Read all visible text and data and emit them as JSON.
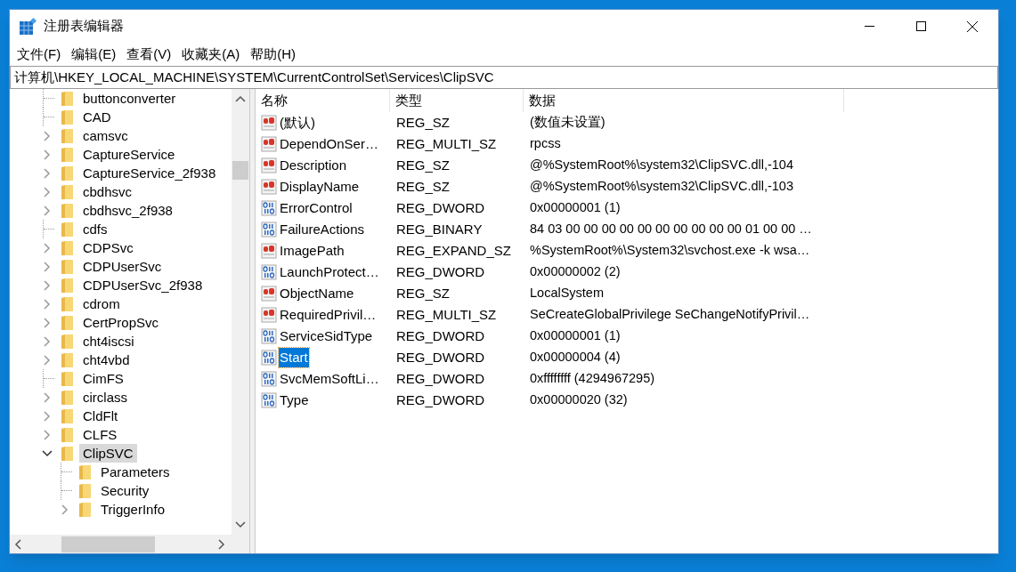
{
  "window": {
    "title": "注册表编辑器"
  },
  "menu": [
    "文件(F)",
    "编辑(E)",
    "查看(V)",
    "收藏夹(A)",
    "帮助(H)"
  ],
  "address": "计算机\\HKEY_LOCAL_MACHINE\\SYSTEM\\CurrentControlSet\\Services\\ClipSVC",
  "tree": [
    {
      "label": "buttonconverter",
      "kind": "leaf",
      "selected": false
    },
    {
      "label": "CAD",
      "kind": "leaf",
      "selected": false
    },
    {
      "label": "camsvc",
      "kind": "branch",
      "expanded": false,
      "selected": false
    },
    {
      "label": "CaptureService",
      "kind": "branch",
      "expanded": false,
      "selected": false
    },
    {
      "label": "CaptureService_2f938",
      "kind": "branch",
      "expanded": false,
      "selected": false
    },
    {
      "label": "cbdhsvc",
      "kind": "branch",
      "expanded": false,
      "selected": false
    },
    {
      "label": "cbdhsvc_2f938",
      "kind": "branch",
      "expanded": false,
      "selected": false
    },
    {
      "label": "cdfs",
      "kind": "leaf",
      "selected": false
    },
    {
      "label": "CDPSvc",
      "kind": "branch",
      "expanded": false,
      "selected": false
    },
    {
      "label": "CDPUserSvc",
      "kind": "branch",
      "expanded": false,
      "selected": false
    },
    {
      "label": "CDPUserSvc_2f938",
      "kind": "branch",
      "expanded": false,
      "selected": false
    },
    {
      "label": "cdrom",
      "kind": "branch",
      "expanded": false,
      "selected": false
    },
    {
      "label": "CertPropSvc",
      "kind": "branch",
      "expanded": false,
      "selected": false
    },
    {
      "label": "cht4iscsi",
      "kind": "branch",
      "expanded": false,
      "selected": false
    },
    {
      "label": "cht4vbd",
      "kind": "branch",
      "expanded": false,
      "selected": false
    },
    {
      "label": "CimFS",
      "kind": "leaf",
      "selected": false
    },
    {
      "label": "circlass",
      "kind": "branch",
      "expanded": false,
      "selected": false
    },
    {
      "label": "CldFlt",
      "kind": "branch",
      "expanded": false,
      "selected": false
    },
    {
      "label": "CLFS",
      "kind": "branch",
      "expanded": false,
      "selected": false
    },
    {
      "label": "ClipSVC",
      "kind": "branch",
      "expanded": true,
      "selected": true,
      "children": [
        {
          "label": "Parameters",
          "kind": "leaf",
          "selected": false
        },
        {
          "label": "Security",
          "kind": "leaf",
          "selected": false
        },
        {
          "label": "TriggerInfo",
          "kind": "branch",
          "expanded": false,
          "selected": false
        }
      ]
    }
  ],
  "columns": [
    "名称",
    "类型",
    "数据"
  ],
  "values": [
    {
      "name": "(默认)",
      "type": "REG_SZ",
      "data": "(数值未设置)",
      "kind": "string",
      "selected": false
    },
    {
      "name": "DependOnSer…",
      "type": "REG_MULTI_SZ",
      "data": "rpcss",
      "kind": "string",
      "selected": false
    },
    {
      "name": "Description",
      "type": "REG_SZ",
      "data": "@%SystemRoot%\\system32\\ClipSVC.dll,-104",
      "kind": "string",
      "selected": false
    },
    {
      "name": "DisplayName",
      "type": "REG_SZ",
      "data": "@%SystemRoot%\\system32\\ClipSVC.dll,-103",
      "kind": "string",
      "selected": false
    },
    {
      "name": "ErrorControl",
      "type": "REG_DWORD",
      "data": "0x00000001 (1)",
      "kind": "binary",
      "selected": false
    },
    {
      "name": "FailureActions",
      "type": "REG_BINARY",
      "data": "84 03 00 00 00 00 00 00 00 00 00 00 01 00 00 …",
      "kind": "binary",
      "selected": false
    },
    {
      "name": "ImagePath",
      "type": "REG_EXPAND_SZ",
      "data": "%SystemRoot%\\System32\\svchost.exe -k wsa…",
      "kind": "string",
      "selected": false
    },
    {
      "name": "LaunchProtect…",
      "type": "REG_DWORD",
      "data": "0x00000002 (2)",
      "kind": "binary",
      "selected": false
    },
    {
      "name": "ObjectName",
      "type": "REG_SZ",
      "data": "LocalSystem",
      "kind": "string",
      "selected": false
    },
    {
      "name": "RequiredPrivil…",
      "type": "REG_MULTI_SZ",
      "data": "SeCreateGlobalPrivilege SeChangeNotifyPrivil…",
      "kind": "string",
      "selected": false
    },
    {
      "name": "ServiceSidType",
      "type": "REG_DWORD",
      "data": "0x00000001 (1)",
      "kind": "binary",
      "selected": false
    },
    {
      "name": "Start",
      "type": "REG_DWORD",
      "data": "0x00000004 (4)",
      "kind": "binary",
      "selected": true
    },
    {
      "name": "SvcMemSoftLi…",
      "type": "REG_DWORD",
      "data": "0xffffffff (4294967295)",
      "kind": "binary",
      "selected": false
    },
    {
      "name": "Type",
      "type": "REG_DWORD",
      "data": "0x00000020 (32)",
      "kind": "binary",
      "selected": false
    }
  ]
}
